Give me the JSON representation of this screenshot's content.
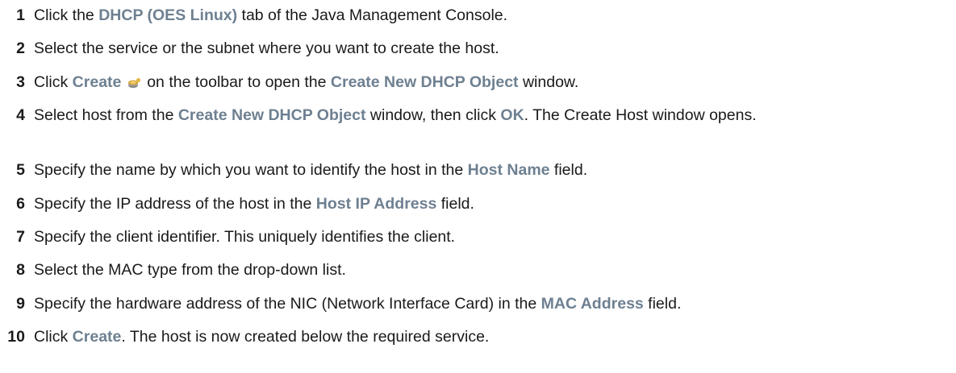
{
  "steps": [
    {
      "number": "1",
      "parts": [
        {
          "text": "Click the "
        },
        {
          "text": "DHCP (OES Linux)",
          "ui": true
        },
        {
          "text": " tab of the Java Management Console."
        }
      ]
    },
    {
      "number": "2",
      "parts": [
        {
          "text": "Select the service or the subnet where you want to create the host."
        }
      ]
    },
    {
      "number": "3",
      "parts": [
        {
          "text": "Click "
        },
        {
          "text": "Create",
          "ui": true
        },
        {
          "icon": "create-icon"
        },
        {
          "text": " on the toolbar to open the "
        },
        {
          "text": "Create New DHCP Object",
          "ui": true
        },
        {
          "text": " window."
        }
      ]
    },
    {
      "number": "4",
      "parts": [
        {
          "text": "Select host from the "
        },
        {
          "text": "Create New DHCP Object",
          "ui": true
        },
        {
          "text": " window, then click "
        },
        {
          "text": "OK",
          "ui": true
        },
        {
          "text": ". The Create Host window opens."
        }
      ]
    },
    {
      "number": "5",
      "parts": [
        {
          "text": "Specify the name by which you want to identify the host in the "
        },
        {
          "text": "Host Name",
          "ui": true
        },
        {
          "text": " field."
        }
      ]
    },
    {
      "number": "6",
      "parts": [
        {
          "text": "Specify the IP address of the host in the "
        },
        {
          "text": "Host IP Address",
          "ui": true
        },
        {
          "text": " field."
        }
      ]
    },
    {
      "number": "7",
      "parts": [
        {
          "text": "Specify the client identifier. This uniquely identifies the client."
        }
      ]
    },
    {
      "number": "8",
      "parts": [
        {
          "text": "Select the MAC type from the drop-down list."
        }
      ]
    },
    {
      "number": "9",
      "parts": [
        {
          "text": "Specify the hardware address of the NIC (Network Interface Card) in the "
        },
        {
          "text": "MAC Address",
          "ui": true
        },
        {
          "text": " field."
        }
      ]
    },
    {
      "number": "10",
      "parts": [
        {
          "text": "Click "
        },
        {
          "text": "Create",
          "ui": true
        },
        {
          "text": ". The host is now created below the required service."
        }
      ]
    }
  ],
  "colors": {
    "ui_text": "#6e8091",
    "body_text": "#1a1a1a",
    "icon_gold": "#d8a93a",
    "icon_gray": "#8f8f8f"
  }
}
